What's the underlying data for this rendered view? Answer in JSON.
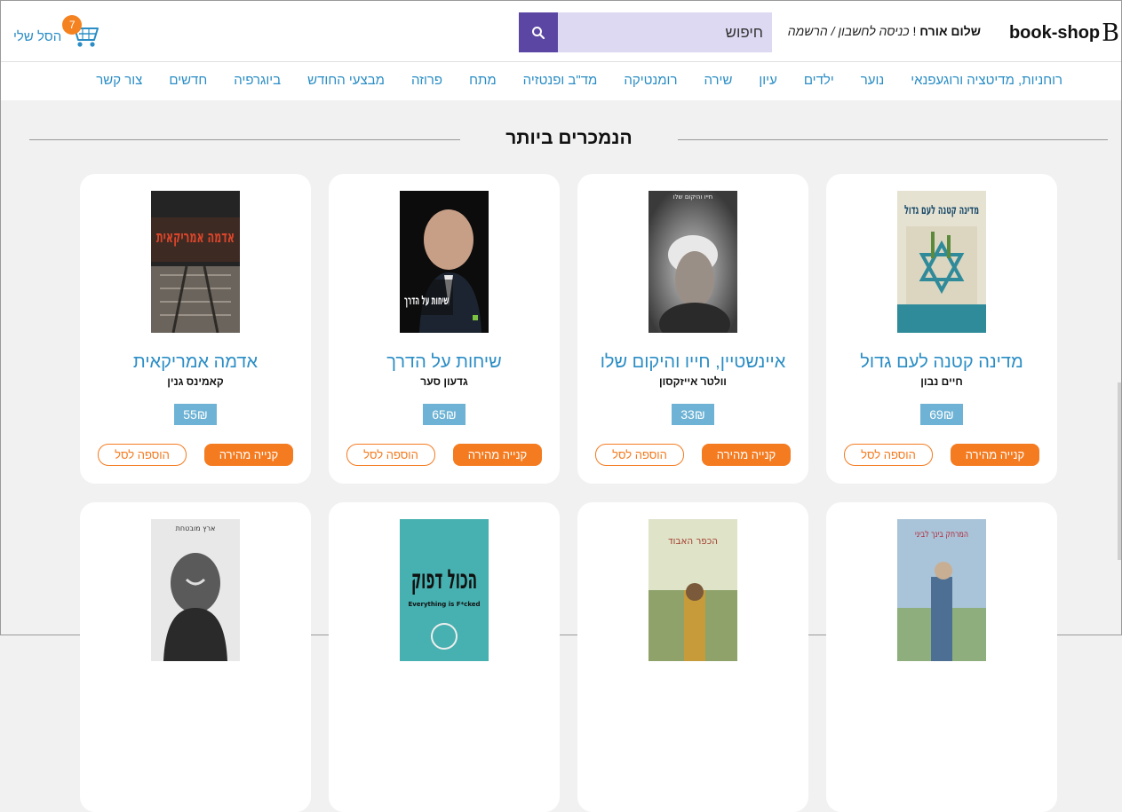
{
  "header": {
    "logo_mark": "B",
    "logo_text": "book-shop",
    "greeting": "שלום אורח",
    "greeting_bang": " ! ",
    "login_link": "כניסה לחשבון",
    "link_sep": " / ",
    "register_link": "הרשמה",
    "search_placeholder": "חיפוש",
    "cart_label": "הסל שלי",
    "cart_count": "7"
  },
  "nav": {
    "items": [
      "צור קשר",
      "חדשים",
      "ביוגרפיה",
      "מבצעי החודש",
      "פרוזה",
      "מתח",
      "מד\"ב ופנטזיה",
      "רומנטיקה",
      "שירה",
      "עיון",
      "ילדים",
      "נוער",
      "פנאי",
      "רוחניות, מדיטציה ורוגע"
    ]
  },
  "section": {
    "title": "הנמכרים ביותר"
  },
  "buttons": {
    "buy": "קנייה מהירה",
    "add": "הוספה לסל"
  },
  "books": [
    {
      "title": "מדינה קטנה לעם גדול",
      "author": "חיים נבון",
      "price": "69₪",
      "cover_text": "מדינה קטנה לעם גדול"
    },
    {
      "title": "איינשטיין, חייו והיקום שלו",
      "author": "וולטר אייזקסון",
      "price": "33₪",
      "cover_text": "חייו והיקום שלו"
    },
    {
      "title": "שיחות על הדרך",
      "author": "גדעון סער",
      "price": "65₪",
      "cover_text": "שיחות על הדרך"
    },
    {
      "title": "אדמה אמריקאית",
      "author": "קאמינס גנין",
      "price": "55₪",
      "cover_text": "אדמה אמריקאית"
    },
    {
      "cover_text": "המרחק בינך לביני"
    },
    {
      "cover_text": "הכפר האבוד"
    },
    {
      "cover_text": "הכול דפוק",
      "cover_sub": "Everything is F*cked"
    },
    {
      "cover_text": "ארץ מובטחת"
    }
  ]
}
